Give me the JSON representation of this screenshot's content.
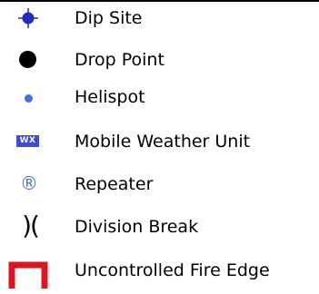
{
  "legend": {
    "items": [
      {
        "label": "Dip Site",
        "symbol": "dip-site-icon",
        "color": "#1f2fbf"
      },
      {
        "label": "Drop Point",
        "symbol": "drop-point-icon",
        "color": "#000000"
      },
      {
        "label": "Helispot",
        "symbol": "helispot-icon",
        "color": "#3f73db"
      },
      {
        "label": "Mobile Weather Unit",
        "symbol": "weather-unit-icon",
        "badge_text": "WX",
        "color": "#3f4ad8"
      },
      {
        "label": "Repeater",
        "symbol": "repeater-icon",
        "glyph": "®",
        "color": "#3f73db"
      },
      {
        "label": "Division Break",
        "symbol": "division-break-icon",
        "glyph": ")(",
        "color": "#000000"
      },
      {
        "label": "Uncontrolled Fire Edge",
        "symbol": "uncontrolled-fire-edge-icon",
        "color": "#e0141e"
      }
    ]
  }
}
